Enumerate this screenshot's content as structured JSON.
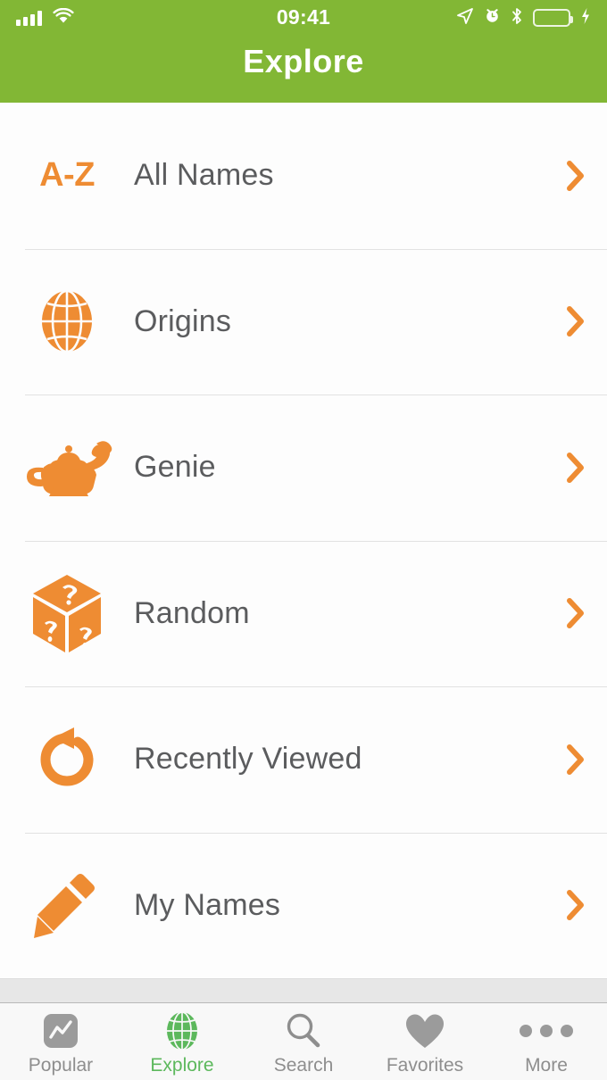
{
  "status_bar": {
    "time": "09:41",
    "icons": {
      "signal": "cellular-signal-icon",
      "wifi": "wifi-icon",
      "location": "location-arrow-icon",
      "alarm": "alarm-clock-icon",
      "bluetooth": "bluetooth-icon",
      "battery": "battery-icon",
      "charging": "charging-bolt-icon"
    }
  },
  "header": {
    "title": "Explore",
    "background_color": "#82B735",
    "title_color": "#FFFFFF"
  },
  "theme": {
    "accent_orange": "#EE8C33",
    "brand_green": "#82B735",
    "tab_active_green": "#5CB85C",
    "label_gray": "#5B5C5E",
    "tab_inactive_gray": "#8E8E8E",
    "divider": "#E2E2E2",
    "page_background": "#FDFDFD"
  },
  "list": {
    "items": [
      {
        "icon": "a-to-z-icon",
        "icon_text": "A-Z",
        "label": "All Names",
        "chevron": "chevron-right-icon"
      },
      {
        "icon": "globe-icon",
        "icon_text": "",
        "label": "Origins",
        "chevron": "chevron-right-icon"
      },
      {
        "icon": "magic-lamp-icon",
        "icon_text": "",
        "label": "Genie",
        "chevron": "chevron-right-icon"
      },
      {
        "icon": "question-dice-icon",
        "icon_text": "",
        "label": "Random",
        "chevron": "chevron-right-icon"
      },
      {
        "icon": "history-rotate-icon",
        "icon_text": "",
        "label": "Recently Viewed",
        "chevron": "chevron-right-icon"
      },
      {
        "icon": "pencil-icon",
        "icon_text": "",
        "label": "My Names",
        "chevron": "chevron-right-icon"
      }
    ]
  },
  "tab_bar": {
    "tabs": [
      {
        "label": "Popular",
        "icon": "chart-line-icon",
        "active": false
      },
      {
        "label": "Explore",
        "icon": "globe-icon",
        "active": true
      },
      {
        "label": "Search",
        "icon": "search-icon",
        "active": false
      },
      {
        "label": "Favorites",
        "icon": "heart-icon",
        "active": false
      },
      {
        "label": "More",
        "icon": "ellipsis-icon",
        "active": false
      }
    ]
  }
}
